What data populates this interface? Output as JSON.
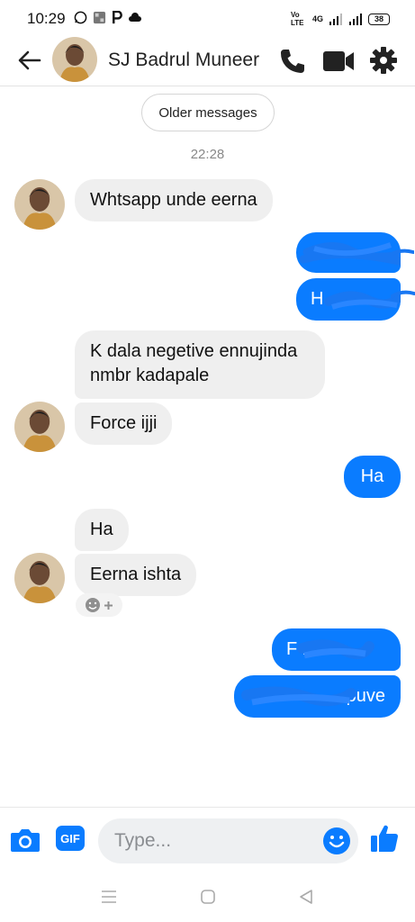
{
  "status_bar": {
    "time": "10:29",
    "battery": "38",
    "network_label": "4G",
    "carrier_label": "Vo LTE"
  },
  "header": {
    "contact_name": "SJ Badrul Muneer"
  },
  "conversation": {
    "older_messages_label": "Older messages",
    "timestamp": "22:28",
    "messages": [
      {
        "direction": "incoming",
        "text": "Whtsapp unde eerna"
      },
      {
        "direction": "outgoing",
        "text": "W__ and",
        "redacted": true
      },
      {
        "direction": "outgoing",
        "text": "Ha_ _ a",
        "redacted": true
      },
      {
        "direction": "incoming",
        "text": "K dala negetive ennujinda nmbr kadapale"
      },
      {
        "direction": "incoming",
        "text": "Force ijji"
      },
      {
        "direction": "outgoing",
        "text": "Ha"
      },
      {
        "direction": "incoming",
        "text": "Ha"
      },
      {
        "direction": "incoming",
        "text": "Eerna ishta"
      },
      {
        "direction": "outgoing",
        "text": "F ne",
        "redacted": true
      },
      {
        "direction": "outgoing",
        "text": "puve",
        "redacted": true
      }
    ]
  },
  "composer": {
    "placeholder": "Type...",
    "gif_label": "GIF"
  },
  "colors": {
    "accent": "#0a7cff",
    "incoming_bubble": "#efefef",
    "scribble": "#1877f2"
  },
  "icons": [
    "back-arrow-icon",
    "phone-icon",
    "video-camera-icon",
    "gear-icon",
    "camera-icon",
    "gif-icon",
    "emoji-icon",
    "thumbs-up-icon",
    "menu-icon",
    "home-icon",
    "back-triangle-icon"
  ]
}
